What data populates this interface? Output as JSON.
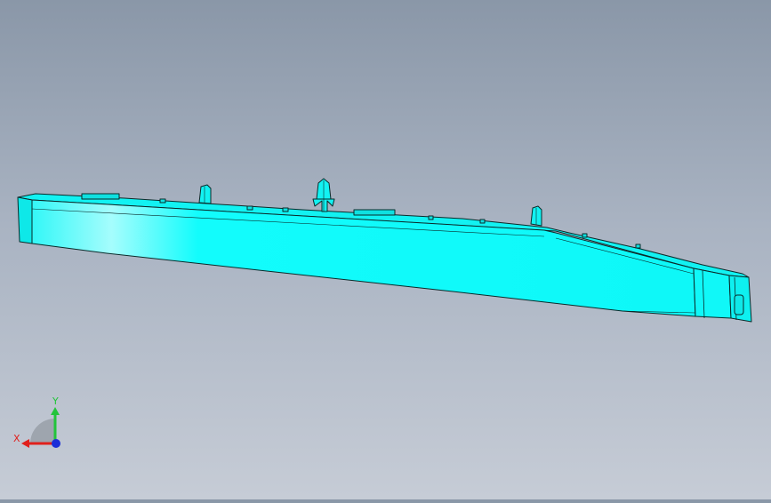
{
  "viewport": {
    "background_top": "#8a97a8",
    "background_bottom": "#c6ccd6"
  },
  "model": {
    "fill_color": "#10fcfc",
    "highlight_color": "#9bfdfd",
    "edge_color": "#0a2a2a"
  },
  "triad": {
    "x_label": "X",
    "y_label": "Y",
    "x_color": "#e0201c",
    "y_color": "#22c43a",
    "z_color": "#1a2ed8"
  }
}
